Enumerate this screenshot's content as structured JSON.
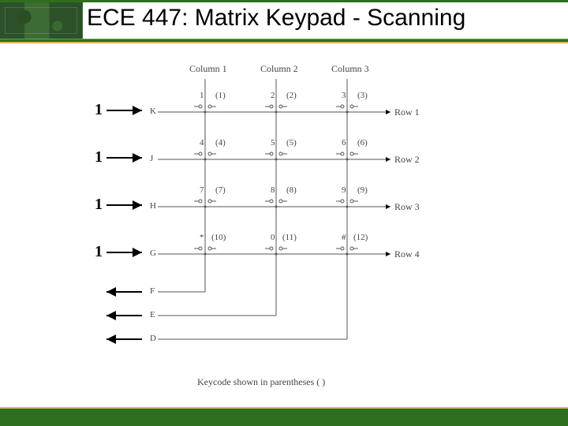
{
  "header": {
    "title": "ECE 447: Matrix Keypad - Scanning"
  },
  "rows": {
    "inputs": [
      "1",
      "1",
      "1",
      "1"
    ],
    "pins": [
      "K",
      "J",
      "H",
      "G"
    ],
    "labels": [
      "Row 1",
      "Row 2",
      "Row 3",
      "Row 4"
    ]
  },
  "cols": {
    "labels": [
      "Column 1",
      "Column 2",
      "Column 3"
    ],
    "pins": [
      "F",
      "E",
      "D"
    ]
  },
  "keys": [
    {
      "cap": "1",
      "code": "(1)"
    },
    {
      "cap": "2",
      "code": "(2)"
    },
    {
      "cap": "3",
      "code": "(3)"
    },
    {
      "cap": "4",
      "code": "(4)"
    },
    {
      "cap": "5",
      "code": "(5)"
    },
    {
      "cap": "6",
      "code": "(6)"
    },
    {
      "cap": "7",
      "code": "(7)"
    },
    {
      "cap": "8",
      "code": "(8)"
    },
    {
      "cap": "9",
      "code": "(9)"
    },
    {
      "cap": "*",
      "code": "(10)"
    },
    {
      "cap": "0",
      "code": "(11)"
    },
    {
      "cap": "#",
      "code": "(12)"
    }
  ],
  "caption": "Keycode shown in parentheses ( )"
}
